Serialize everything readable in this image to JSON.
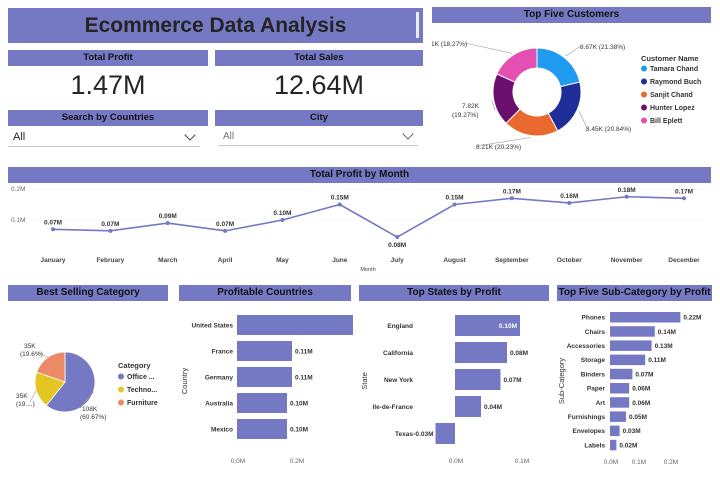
{
  "header": {
    "title": "Ecommerce Data Analysis"
  },
  "kpis": {
    "profit_label": "Total Profit",
    "profit_value": "1.47M",
    "sales_label": "Total Sales",
    "sales_value": "12.64M"
  },
  "slicers": {
    "country_label": "Search by Countries",
    "country_value": "All",
    "city_label": "City",
    "city_value": "All"
  },
  "colors": {
    "header_band": "#7579c4",
    "bar": "#7579c4",
    "line": "#7579c4"
  },
  "chart_data": [
    {
      "id": "top_customers",
      "type": "pie",
      "title": "Top Five Customers",
      "legend_title": "Customer Name",
      "legend_position": "right",
      "slices": [
        {
          "name": "Tamara Chand",
          "value": 8.67,
          "label": "8.67K (21.38%)",
          "color": "#1f9bf1"
        },
        {
          "name": "Raymond Buch",
          "value": 8.45,
          "label": "8.45K (20.84%)",
          "color": "#1f2d99"
        },
        {
          "name": "Sanjit Chand",
          "value": 8.21,
          "label": "8.21K (20.23%)",
          "color": "#e9692f"
        },
        {
          "name": "Hunter Lopez",
          "value": 7.82,
          "label": "7.82K (19.27%)",
          "color": "#6a0f6e"
        },
        {
          "name": "Bill Eplett",
          "value": 7.41,
          "label": "7.41K (18.27%)",
          "color": "#e44fb4"
        }
      ]
    },
    {
      "id": "profit_by_month",
      "type": "line",
      "title": "Total Profit by Month",
      "xlabel": "Month",
      "ylabel": "",
      "ylim": [
        0,
        0.2
      ],
      "yticks": [
        "0.2M",
        "0.1M"
      ],
      "categories": [
        "January",
        "February",
        "March",
        "April",
        "May",
        "June",
        "July",
        "August",
        "September",
        "October",
        "November",
        "December"
      ],
      "values": [
        0.07,
        0.065,
        0.09,
        0.065,
        0.1,
        0.15,
        0.045,
        0.15,
        0.17,
        0.155,
        0.175,
        0.17
      ],
      "labels": [
        "0.07M",
        "0.07M",
        "0.09M",
        "0.07M",
        "0.10M",
        "0.15M",
        "0.08M",
        "0.15M",
        "0.17M",
        "0.16M",
        "0.18M",
        "0.17M"
      ]
    },
    {
      "id": "best_category",
      "type": "pie",
      "title": "Best Selling Category",
      "legend_title": "Category",
      "legend_position": "right",
      "slices": [
        {
          "name": "Office ...",
          "value": 108,
          "label": "108K",
          "sublabel": "(60.67%)",
          "color": "#7579c4"
        },
        {
          "name": "Techno...",
          "value": 35,
          "label": "35K",
          "sublabel": "(19....)",
          "color": "#e3c523"
        },
        {
          "name": "Furniture",
          "value": 35,
          "label": "35K",
          "sublabel": "(19.6%)",
          "color": "#ec8a68"
        }
      ]
    },
    {
      "id": "profitable_countries",
      "type": "bar",
      "title": "Profitable Countries",
      "ylabel": "Country",
      "xlim": [
        0,
        0.2
      ],
      "xticks": [
        "0.0M",
        "0.2M"
      ],
      "categories": [
        "United States",
        "France",
        "Germany",
        "Australia",
        "Mexico"
      ],
      "values": [
        0.29,
        0.11,
        0.11,
        0.1,
        0.1
      ],
      "labels": [
        "0.29M",
        "0.11M",
        "0.11M",
        "0.10M",
        "0.10M"
      ]
    },
    {
      "id": "top_states",
      "type": "bar",
      "title": "Top States by Profit",
      "ylabel": "State",
      "xlim": [
        -0.03,
        0.1
      ],
      "xticks": [
        "0.0M",
        "0.1M"
      ],
      "categories": [
        "England",
        "California",
        "New York",
        "Ile-de-France",
        "Texas"
      ],
      "values": [
        0.1,
        0.08,
        0.07,
        0.04,
        -0.03
      ],
      "labels": [
        "0.10M",
        "0.08M",
        "0.07M",
        "0.04M",
        "-0.03M"
      ]
    },
    {
      "id": "top_subcategories",
      "type": "bar",
      "title": "Top Five Sub-Category by Profit",
      "ylabel": "Sub-Category",
      "xlim": [
        0,
        0.2
      ],
      "xticks": [
        "0.0M",
        "0.1M",
        "0.2M"
      ],
      "categories": [
        "Phones",
        "Chairs",
        "Accessories",
        "Storage",
        "Binders",
        "Paper",
        "Art",
        "Furnishings",
        "Envelopes",
        "Labels"
      ],
      "values": [
        0.22,
        0.14,
        0.13,
        0.11,
        0.07,
        0.06,
        0.06,
        0.05,
        0.03,
        0.02
      ],
      "labels": [
        "0.22M",
        "0.14M",
        "0.13M",
        "0.11M",
        "0.07M",
        "0.06M",
        "0.06M",
        "0.05M",
        "0.03M",
        "0.02M"
      ]
    }
  ]
}
